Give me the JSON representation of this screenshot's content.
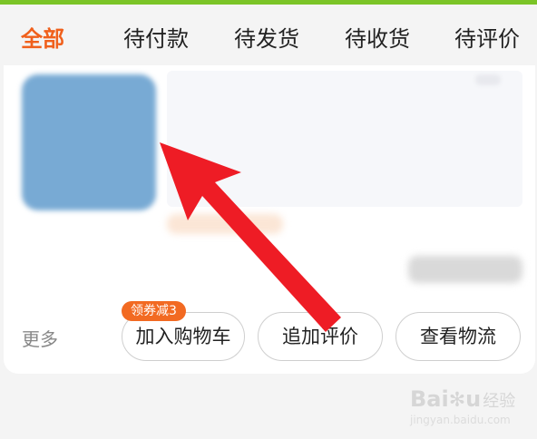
{
  "tabs": [
    {
      "label": "全部",
      "active": true
    },
    {
      "label": "待付款",
      "active": false
    },
    {
      "label": "待发货",
      "active": false
    },
    {
      "label": "待收货",
      "active": false
    },
    {
      "label": "待评价",
      "active": false
    }
  ],
  "order_card": {
    "more_label": "更多",
    "coupon_badge": "领券减3",
    "buttons": {
      "add_to_cart": "加入购物车",
      "add_review": "追加评价",
      "view_logistics": "查看物流"
    }
  },
  "watermark": {
    "brand": "Bai",
    "brand_tail": "u",
    "cn": "经验",
    "url": "jingyan.baidu.com"
  },
  "colors": {
    "accent": "#f0601c",
    "annotation_arrow": "#ee1c25",
    "top_strip": "#7bc427",
    "thumbnail": "#78aad4"
  }
}
